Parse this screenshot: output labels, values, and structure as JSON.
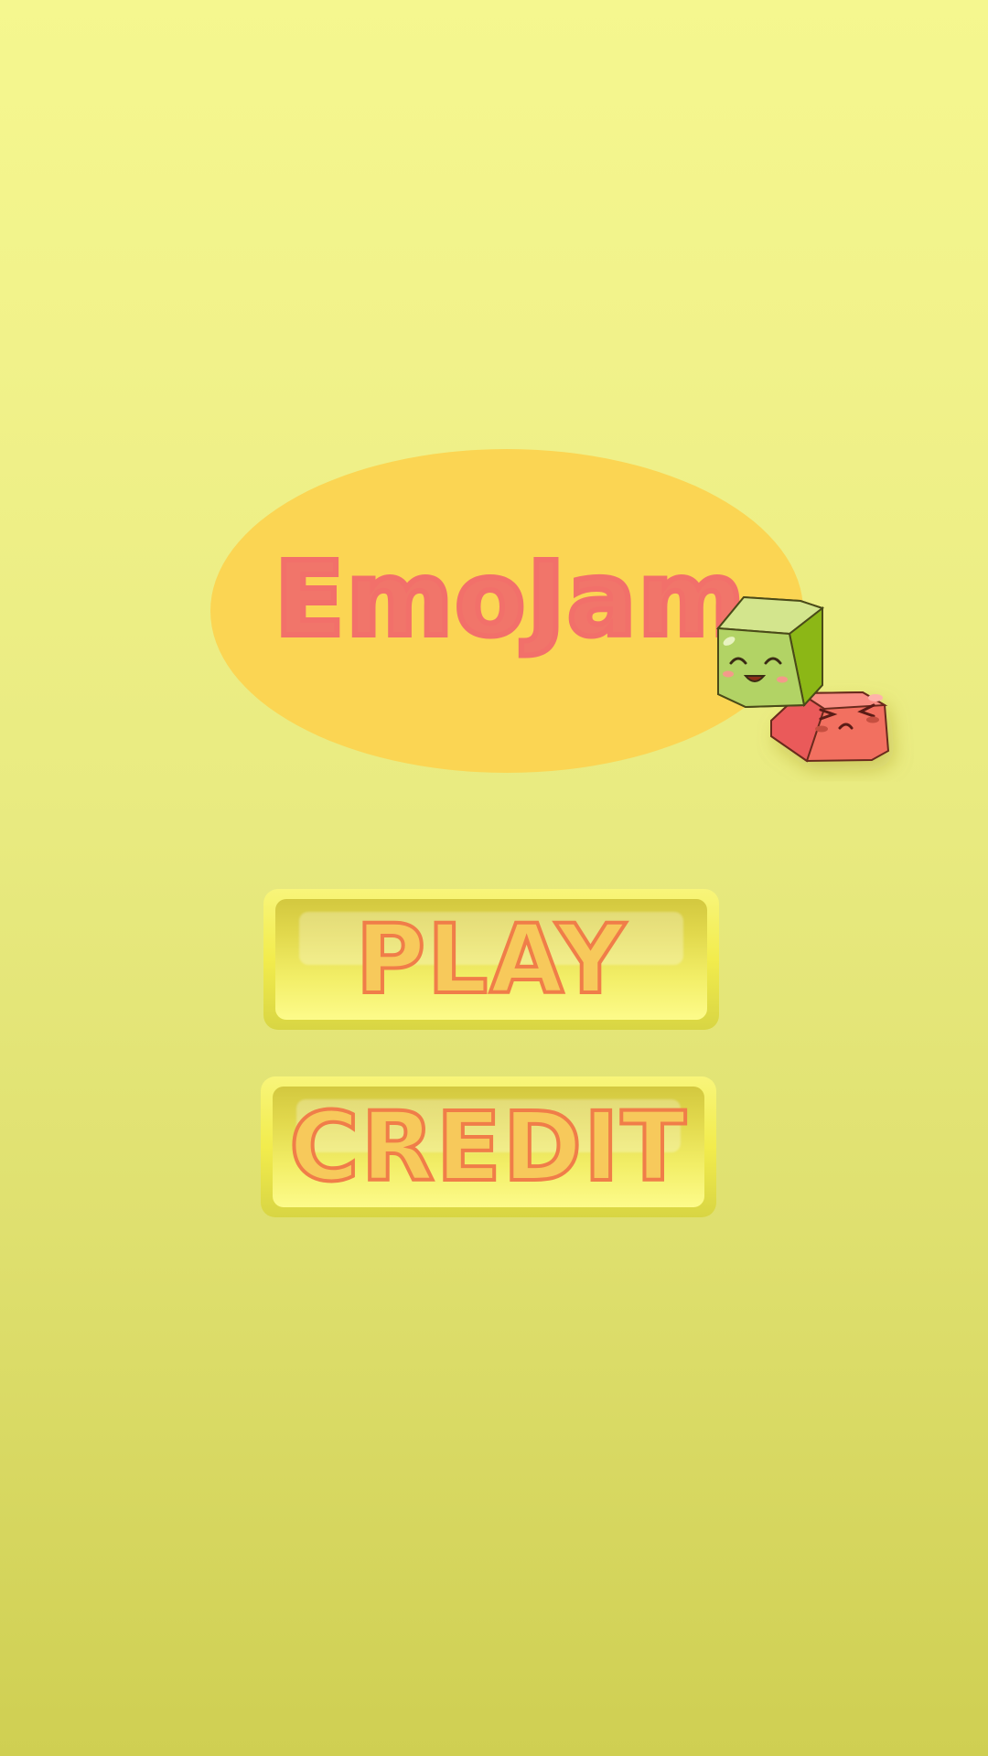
{
  "game": {
    "title": "EmoJam"
  },
  "menu": {
    "play_label": "PLAY",
    "credit_label": "CREDIT"
  },
  "colors": {
    "background_top": "#f5f78f",
    "background_bottom": "#cfcf52",
    "title_blob": "#fbd553",
    "title_text": "#f1756a",
    "button_text_fill": "#f7c95b",
    "button_text_outline": "#f07d49",
    "green_cube": "#b2d365",
    "red_cube": "#f26f61"
  },
  "icons": {
    "mascot": "happy-green-cube-and-grumpy-red-cube"
  }
}
